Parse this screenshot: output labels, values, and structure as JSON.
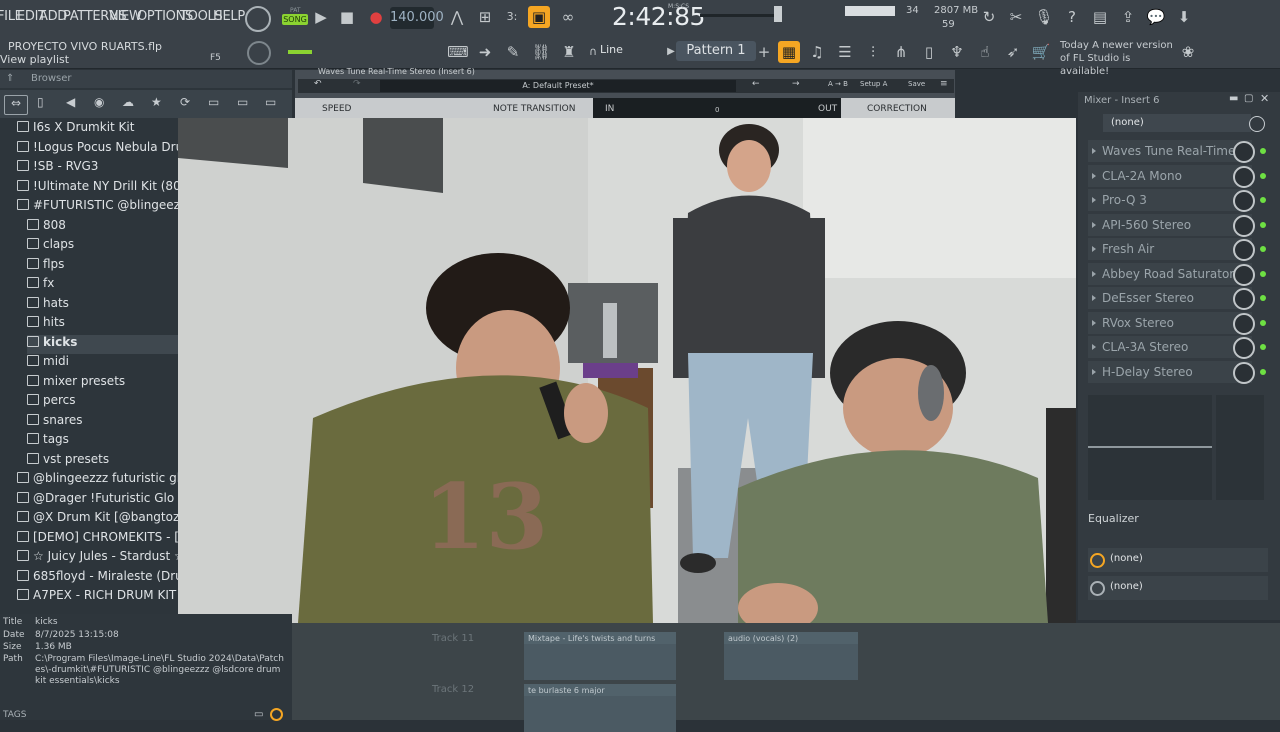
{
  "menu": [
    "FILE",
    "EDIT",
    "ADD",
    "PATTERNS",
    "VIEW",
    "OPTIONS",
    "TOOLS",
    "HELP"
  ],
  "transport": {
    "pat_label": "PAT",
    "song_label": "SONG",
    "bpm": "140.000",
    "time": "2:42:85",
    "time_unit": "M:S:CS"
  },
  "cpu": {
    "voices": "34",
    "memory": "2807 MB",
    "polyphony": "59"
  },
  "project": {
    "file": "PROYECTO VIVO RUARTS.flp",
    "hint": "View playlist",
    "shortcut": "F5"
  },
  "toolbar": {
    "snap": "Line",
    "pattern": "Pattern 1"
  },
  "news": "Today  A newer version of FL Studio is available!",
  "browser": {
    "title": "Browser",
    "items": [
      {
        "label": "I6s X Drumkit Kit",
        "type": "folder",
        "indent": 0
      },
      {
        "label": "!Logus Pocus Nebula Drum Kit",
        "type": "folder",
        "indent": 0
      },
      {
        "label": "!SB - RVG3",
        "type": "folder",
        "indent": 0
      },
      {
        "label": "!Ultimate NY Drill Kit (808 Mafia)",
        "type": "folder",
        "indent": 0
      },
      {
        "label": "#FUTURISTIC @blingeezzz.sdcore",
        "type": "folder-open",
        "indent": 0
      },
      {
        "label": "808",
        "type": "folder",
        "indent": 1
      },
      {
        "label": "claps",
        "type": "folder",
        "indent": 1
      },
      {
        "label": "flps",
        "type": "folder",
        "indent": 1
      },
      {
        "label": "fx",
        "type": "folder",
        "indent": 1
      },
      {
        "label": "hats",
        "type": "folder",
        "indent": 1
      },
      {
        "label": "hits",
        "type": "folder",
        "indent": 1
      },
      {
        "label": "kicks",
        "type": "folder-selected",
        "indent": 1
      },
      {
        "label": "midi",
        "type": "folder",
        "indent": 1
      },
      {
        "label": "mixer presets",
        "type": "folder",
        "indent": 1
      },
      {
        "label": "percs",
        "type": "folder",
        "indent": 1
      },
      {
        "label": "snares",
        "type": "folder",
        "indent": 1
      },
      {
        "label": "tags",
        "type": "folder",
        "indent": 1
      },
      {
        "label": "vst presets",
        "type": "folder",
        "indent": 1
      },
      {
        "label": "@blingeezzz futuristic glo drum",
        "type": "folder",
        "indent": 0
      },
      {
        "label": "@Drager !Futuristic Glo Drum",
        "type": "folder",
        "indent": 0
      },
      {
        "label": "@X Drum Kit [@bangtozzy & @",
        "type": "folder",
        "indent": 0
      },
      {
        "label": "[DEMO] CHROMEKITS - [800.Y",
        "type": "folder",
        "indent": 0
      },
      {
        "label": "☆ Juicy Jules - Stardust ☆",
        "type": "folder",
        "indent": 0
      },
      {
        "label": "685floyd - Miraleste (Drum Kit)",
        "type": "folder",
        "indent": 0
      },
      {
        "label": "A7PEX - RICH DRUM KIT",
        "type": "folder",
        "indent": 0
      }
    ]
  },
  "info": {
    "title_label": "Title",
    "title_value": "kicks",
    "date_label": "Date",
    "date_value": "8/7/2025 13:15:08",
    "size_label": "Size",
    "size_value": "1.36 MB",
    "path_label": "Path",
    "path_value": "C:\\Program Files\\Image-Line\\FL Studio 2024\\Data\\Patches\\-drumkit\\#FUTURISTIC @blingeezzz @lsdcore drum kit essentials\\kicks",
    "tags_label": "TAGS"
  },
  "plugin": {
    "title": "Waves Tune Real-Time Stereo (Insert 6)",
    "preset": "A: Default Preset*",
    "ab": "A → B",
    "setup": "Setup A",
    "save": "Save",
    "speed": "SPEED",
    "note_transition": "NOTE TRANSITION",
    "in": "IN",
    "zero": "0",
    "out": "OUT",
    "correction": "CORRECTION"
  },
  "mixer": {
    "title": "Mixer - Insert 6",
    "top_slot": "(none)",
    "slots": [
      "Waves Tune Real-Time...",
      "CLA-2A Mono",
      "Pro-Q 3",
      "API-560 Stereo",
      "Fresh Air",
      "Abbey Road Saturator...",
      "DeEsser Stereo",
      "RVox Stereo",
      "CLA-3A Stereo",
      "H-Delay Stereo"
    ],
    "eq_label": "Equalizer",
    "out1": "(none)",
    "out2": "(none)",
    "led_color": "#6ee043"
  },
  "playlist": {
    "track11": "Track 11",
    "track12": "Track 12",
    "clips": [
      "Mixtape - Life's twists and turns",
      "audio (vocals) (2)",
      "te burlaste 6 major"
    ]
  },
  "colors": {
    "accent_orange": "#f5a623",
    "song_green": "#8bd331",
    "record_red": "#e04040"
  }
}
